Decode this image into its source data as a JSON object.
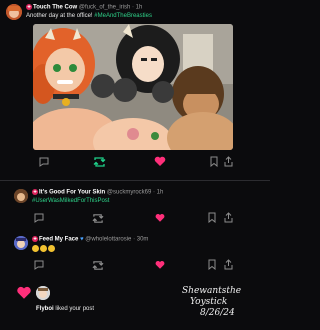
{
  "post": {
    "author_name": "Touch The Cow",
    "author_handle": "@fuck_of_the_irish",
    "time": "· 1h",
    "text": "Another day at the office!",
    "hashtag": "#MeAndTheBreasties",
    "colors": {
      "hashtag": "#2fd38a",
      "heart": "#ff2f7a",
      "retweet": "#1fd18a"
    }
  },
  "replies": [
    {
      "author_name": "It's Good For Your Skin",
      "author_handle": "@suckmyrock69",
      "time": "· 1h",
      "hashtag": "#UserWasMilkedForThisPost"
    },
    {
      "author_name": "Feed My Face",
      "author_handle": "@wholelottarosie",
      "time": "· 30m"
    }
  ],
  "notification": {
    "user": "Flyboi",
    "action": "liked your post"
  },
  "signature": {
    "line1": "Shewantsthe",
    "line2": "Yoystick",
    "date": "8/26/24"
  }
}
